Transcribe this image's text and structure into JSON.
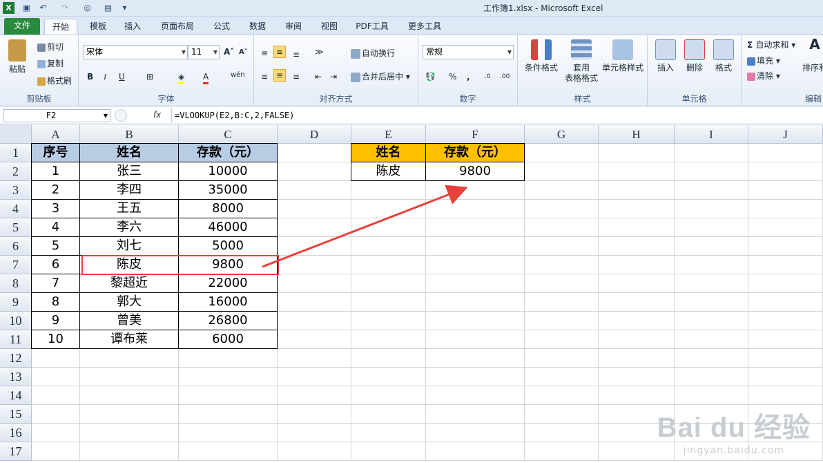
{
  "window": {
    "title": "工作簿1.xlsx - Microsoft Excel"
  },
  "tabs": [
    "文件",
    "开始",
    "模板",
    "插入",
    "页面布局",
    "公式",
    "数据",
    "审阅",
    "视图",
    "PDF工具",
    "更多工具"
  ],
  "ribbon": {
    "clipboard": {
      "paste": "粘贴",
      "cut": "剪切",
      "copy": "复制",
      "format_painter": "格式刷",
      "label": "剪贴板"
    },
    "font": {
      "name": "宋体",
      "size": "11",
      "label": "字体"
    },
    "alignment": {
      "wrap": "自动换行",
      "merge": "合并后居中",
      "label": "对齐方式"
    },
    "number": {
      "format": "常规",
      "label": "数字"
    },
    "styles": {
      "conditional": "条件格式",
      "table_1": "套用",
      "table_2": "表格格式",
      "cell_styles": "单元格样式",
      "label": "样式"
    },
    "cells": {
      "insert": "插入",
      "delete": "删除",
      "format": "格式",
      "label": "单元格"
    },
    "editing": {
      "autosum": "自动求和",
      "fill": "填充",
      "clear": "清除",
      "sort": "排序和",
      "label": "编辑"
    }
  },
  "formula_bar": {
    "name_box": "F2",
    "fx": "fx",
    "formula": "=VLOOKUP(E2,B:C,2,FALSE)"
  },
  "columns": [
    "A",
    "B",
    "C",
    "D",
    "E",
    "F",
    "G",
    "H",
    "I",
    "J"
  ],
  "rows": [
    "1",
    "2",
    "3",
    "4",
    "5",
    "6",
    "7",
    "8",
    "9",
    "10",
    "11",
    "12",
    "13",
    "14",
    "15",
    "16",
    "17"
  ],
  "table": {
    "headers": [
      "序号",
      "姓名",
      "存款（元）"
    ],
    "rows": [
      [
        "1",
        "张三",
        "10000"
      ],
      [
        "2",
        "李四",
        "35000"
      ],
      [
        "3",
        "王五",
        "8000"
      ],
      [
        "4",
        "李六",
        "46000"
      ],
      [
        "5",
        "刘七",
        "5000"
      ],
      [
        "6",
        "陈皮",
        "9800"
      ],
      [
        "7",
        "黎超近",
        "22000"
      ],
      [
        "8",
        "郭大",
        "16000"
      ],
      [
        "9",
        "曾美",
        "26800"
      ],
      [
        "10",
        "谭布莱",
        "6000"
      ]
    ]
  },
  "lookup": {
    "headers": [
      "姓名",
      "存款（元）"
    ],
    "row": [
      "陈皮",
      "9800"
    ]
  },
  "watermark": {
    "brand": "Bai du 经验",
    "url": "jingyan.baidu.com"
  },
  "colors": {
    "header_blue": "#b8cce4",
    "header_orange": "#ffc000",
    "highlight_red": "#e8403a",
    "file_tab": "#2a8a3e"
  }
}
